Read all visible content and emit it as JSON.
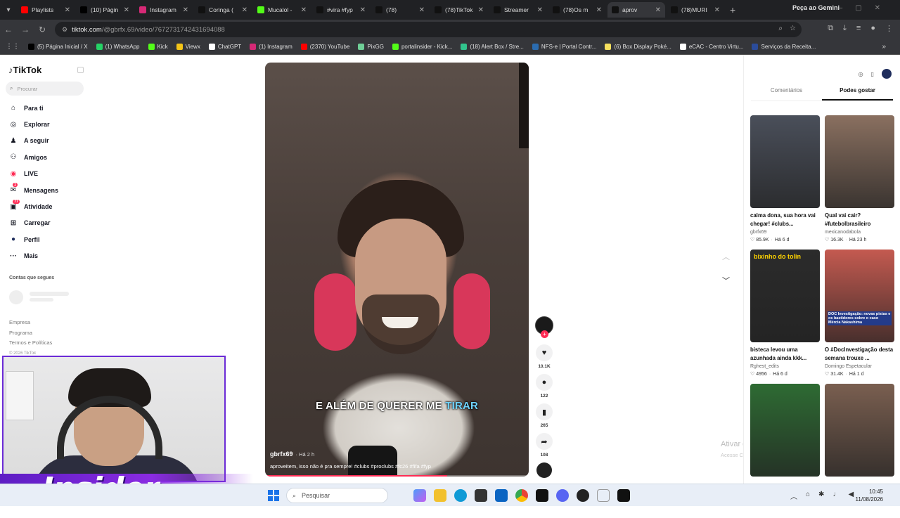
{
  "browser": {
    "tabs": [
      {
        "title": "Playlists",
        "color": "#ff0000"
      },
      {
        "title": "(10) Págin",
        "color": "#000000"
      },
      {
        "title": "Instagram",
        "color": "#d62976"
      },
      {
        "title": "Coringa (",
        "color": "#111111"
      },
      {
        "title": "Mucalol -",
        "color": "#53fc18"
      },
      {
        "title": "#vira #fyp",
        "color": "#111111"
      },
      {
        "title": "(78)",
        "color": "#111111"
      },
      {
        "title": "(78)TikTok",
        "color": "#111111"
      },
      {
        "title": "Streamer",
        "color": "#111111"
      },
      {
        "title": "(78)Os m",
        "color": "#111111"
      },
      {
        "title": "aprov",
        "color": "#111111",
        "active": true
      },
      {
        "title": "(78)MURI",
        "color": "#111111"
      }
    ],
    "gemini_label": "Peça ao Gemini",
    "url_host": "tiktok.com",
    "url_path": "/@gbrfx.69/video/7672731742431694088",
    "bookmarks": [
      {
        "label": "(5) Página Inicial / X",
        "color": "#000000"
      },
      {
        "label": "(1) WhatsApp",
        "color": "#25d366"
      },
      {
        "label": "Kick",
        "color": "#53fc18"
      },
      {
        "label": "Viewx",
        "color": "#f5c518"
      },
      {
        "label": "ChatGPT",
        "color": "#ffffff"
      },
      {
        "label": "(1) Instagram",
        "color": "#d62976"
      },
      {
        "label": "(2370) YouTube",
        "color": "#ff0000"
      },
      {
        "label": "PixGG",
        "color": "#6fcf97"
      },
      {
        "label": "portalinsider - Kick...",
        "color": "#53fc18"
      },
      {
        "label": "(18) Alert Box / Stre...",
        "color": "#31c48d"
      },
      {
        "label": "NFS-e | Portal Contr...",
        "color": "#2b6cb0"
      },
      {
        "label": "(6) Box Display Poké...",
        "color": "#f6e05e"
      },
      {
        "label": "eCAC - Centro Virtu...",
        "color": "#ffffff"
      },
      {
        "label": "Serviços da Receita...",
        "color": "#2b4c9b"
      }
    ]
  },
  "tiktok": {
    "logo": "TikTok",
    "search_placeholder": "Procurar",
    "menu": [
      {
        "label": "Para ti",
        "icon": "home-icon"
      },
      {
        "label": "Explorar",
        "icon": "compass-icon"
      },
      {
        "label": "A seguir",
        "icon": "following-icon"
      },
      {
        "label": "Amigos",
        "icon": "friends-icon"
      },
      {
        "label": "LIVE",
        "icon": "live-icon"
      },
      {
        "label": "Mensagens",
        "icon": "messages-icon",
        "badge": "1"
      },
      {
        "label": "Atividade",
        "icon": "activity-icon",
        "badge": "77"
      },
      {
        "label": "Carregar",
        "icon": "upload-icon"
      },
      {
        "label": "Perfil",
        "icon": "profile-icon"
      },
      {
        "label": "Mais",
        "icon": "more-icon"
      }
    ],
    "follows_title": "Contas que segues",
    "footer": [
      "Empresa",
      "Programa",
      "Termos e Políticas"
    ],
    "copyright": "© 2026 TikTok",
    "video": {
      "caption_main": "E ALÉM DE QUERER ME ",
      "caption_highlight": "TIRAR",
      "username": "gbrfx69",
      "time": "· Há 2 h",
      "description": "aproveitem, isso não é pra sempre! #clubs #proclubs #fc26 #fifa #fyp",
      "progress": 0.69
    },
    "actions": {
      "likes": "10.1K",
      "comments": "122",
      "saves": "265",
      "shares": "108"
    },
    "right_tabs": [
      "Comentários",
      "Podes gostar"
    ],
    "cards": [
      {
        "title": "calma dona, sua hora vai chegar! #clubs...",
        "author": "gbrfx69",
        "likes": "85.9K",
        "age": "Há 6 d",
        "thumb": "#4a4f5a"
      },
      {
        "title": "Qual vai cair? #futebolbrasileiro",
        "author": "mexicanodabola",
        "likes": "16.3K",
        "age": "Há 23 h",
        "thumb": "#8a7060"
      },
      {
        "title": "bisteca levou uma azunhada ainda kkk...",
        "author": "Rghest_edits",
        "likes": "4956",
        "age": "Há 6 d",
        "thumb": "#2b2b2b",
        "overlay": "bixinho do tolin"
      },
      {
        "title": "O #DocInvestigação desta semana trouxe ...",
        "author": "Domingo Espetacular",
        "likes": "31.4K",
        "age": "Há 1 d",
        "thumb": "#c45a50",
        "overlay": "DOC Investigação: novas pistas e os bastidores sobre o caso Mércia Nakashima"
      },
      {
        "title": "",
        "author": "",
        "likes": "",
        "age": "",
        "thumb": "#2e6b33"
      },
      {
        "title": "",
        "author": "",
        "likes": "",
        "age": "",
        "thumb": "#7a5f50"
      }
    ],
    "watermark_title": "Ativar o Windows",
    "watermark_sub": "Acesse Configurações para ativar o Windows."
  },
  "overlay": {
    "brand": "Insider"
  },
  "taskbar": {
    "search_placeholder": "Pesquisar",
    "time": "10:45",
    "date": "11/08/2026"
  }
}
